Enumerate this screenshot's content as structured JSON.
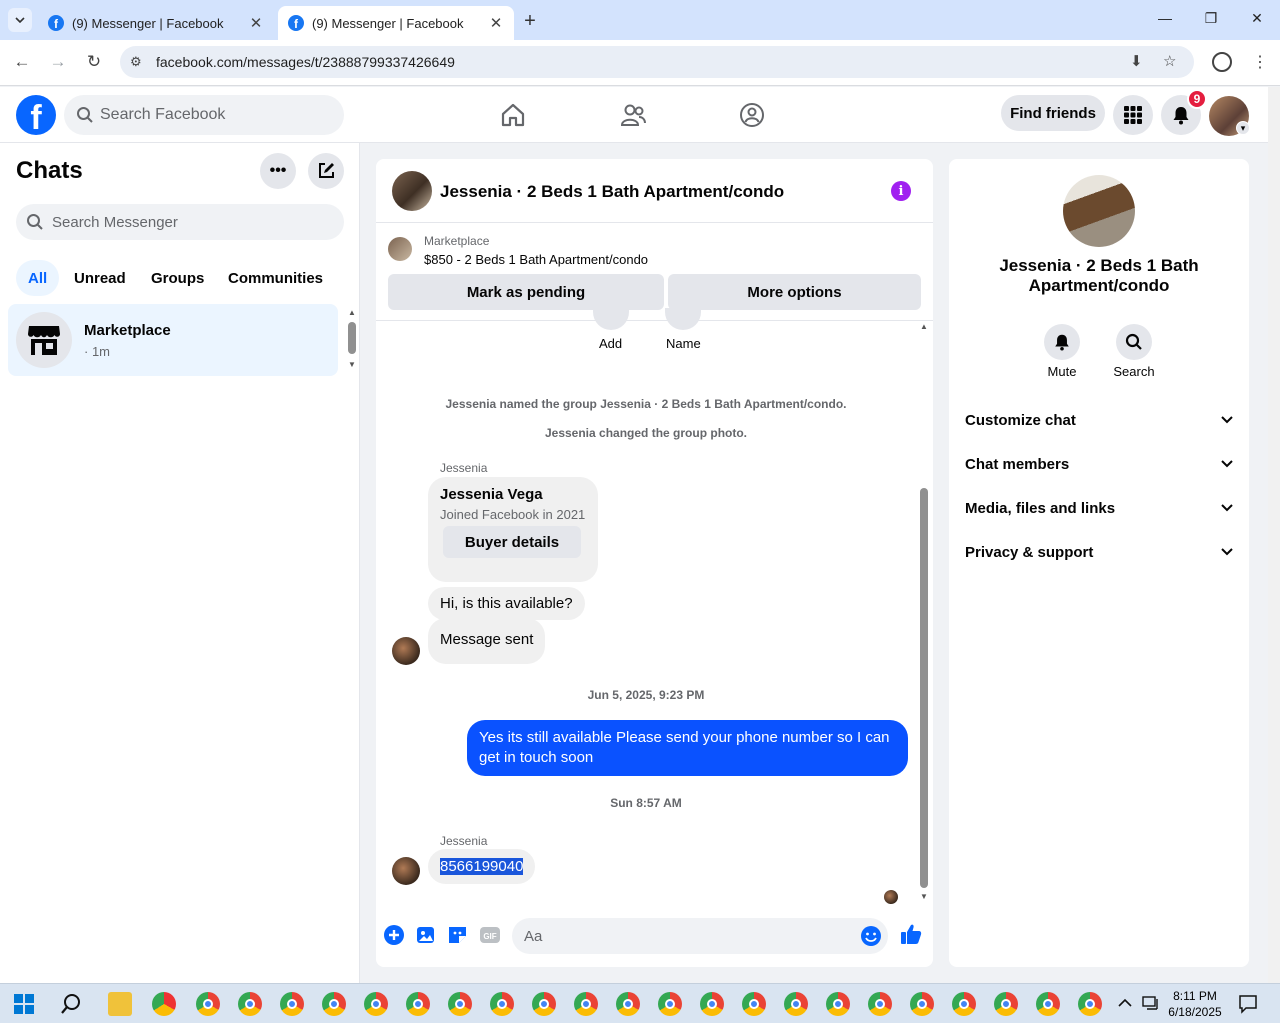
{
  "browser": {
    "tabs": [
      {
        "title": "(9) Messenger | Facebook"
      },
      {
        "title": "(9) Messenger | Facebook"
      }
    ],
    "url": "facebook.com/messages/t/23888799337426649"
  },
  "header": {
    "search_placeholder": "Search Facebook",
    "find_friends": "Find friends",
    "notification_count": "9"
  },
  "left": {
    "title": "Chats",
    "search_placeholder": "Search Messenger",
    "filters": [
      "All",
      "Unread",
      "Groups",
      "Communities"
    ],
    "chat": {
      "name": "Marketplace",
      "time": "· 1m"
    }
  },
  "chat": {
    "title": "Jessenia · 2 Beds 1 Bath Apartment/condo",
    "marketplace_label": "Marketplace",
    "listing": "$850 - 2 Beds 1 Bath Apartment/condo",
    "mark_pending": "Mark as pending",
    "more_options": "More options",
    "add_label": "Add",
    "name_label": "Name",
    "sys1": "Jessenia named the group Jessenia · 2 Beds 1 Bath Apartment/condo.",
    "sys2": "Jessenia changed the group photo.",
    "sender1": "Jessenia",
    "card_name": "Jessenia Vega",
    "card_sub": "Joined Facebook in 2021",
    "buyer_details": "Buyer details",
    "msg1": "Hi, is this available?",
    "msg2": "Message sent",
    "ts1": "Jun 5, 2025, 9:23 PM",
    "out_msg": "Yes its still available Please send your phone number so I can get in touch soon",
    "ts2": "Sun 8:57 AM",
    "sender2": "Jessenia",
    "msg3": "8566199040",
    "composer_placeholder": "Aa"
  },
  "right": {
    "title_line1": "Jessenia · 2 Beds 1 Bath",
    "title_line2": "Apartment/condo",
    "mute": "Mute",
    "search": "Search",
    "sections": [
      "Customize chat",
      "Chat members",
      "Media, files and links",
      "Privacy & support"
    ]
  },
  "taskbar": {
    "time": "8:11 PM",
    "date": "6/18/2025"
  },
  "colors": {
    "accent": "#0866ff",
    "outgoing_bubble": "#0a52ff",
    "info": "#a020f0",
    "badge": "#e41e3f"
  }
}
